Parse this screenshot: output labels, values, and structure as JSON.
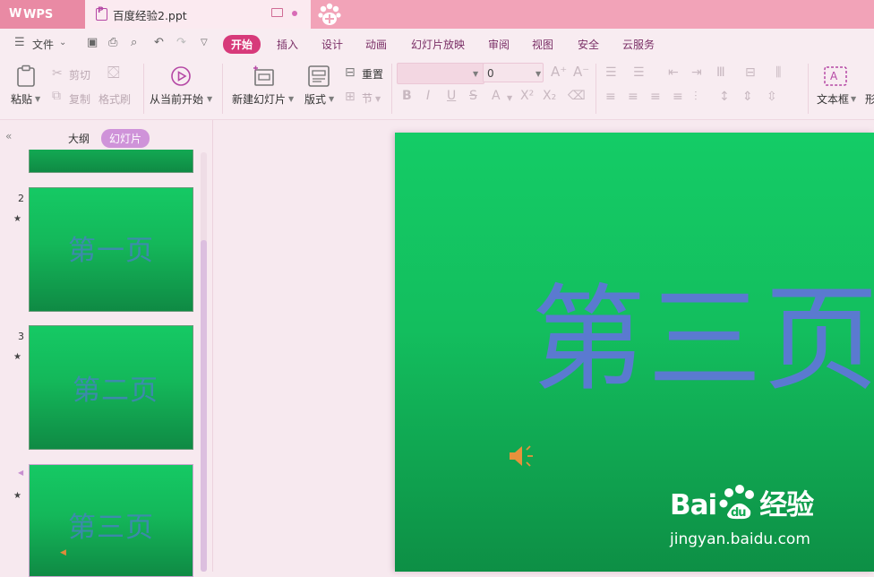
{
  "titlebar": {
    "app_name": "WPS",
    "doc_tab": "百度经验2.ppt"
  },
  "menu": {
    "file": "文件",
    "tabs": [
      "开始",
      "插入",
      "设计",
      "动画",
      "幻灯片放映",
      "审阅",
      "视图",
      "安全",
      "云服务"
    ]
  },
  "ribbon": {
    "paste": "粘贴",
    "cut": "剪切",
    "copy": "复制",
    "format_painter": "格式刷",
    "from_current": "从当前开始",
    "new_slide": "新建幻灯片",
    "layout": "版式",
    "reset": "重置",
    "section": "节",
    "font_size": "0",
    "textbox": "文本框",
    "shape_partial": "形"
  },
  "panel": {
    "tab_outline": "大纲",
    "tab_slides": "幻灯片",
    "slides": [
      {
        "num": "2",
        "title": "第一页"
      },
      {
        "num": "3",
        "title": "第二页"
      },
      {
        "num": "",
        "title": "第三页"
      }
    ]
  },
  "slide": {
    "title": "第三页"
  },
  "watermark": {
    "brand": "Bai",
    "brand_suffix": "经验",
    "url": "jingyan.baidu.com"
  },
  "colors": {
    "titlebar": "#f2a3b8",
    "accent": "#d73a7a",
    "slide_green": "#14cc66",
    "title_blue": "#5a7ad0"
  }
}
